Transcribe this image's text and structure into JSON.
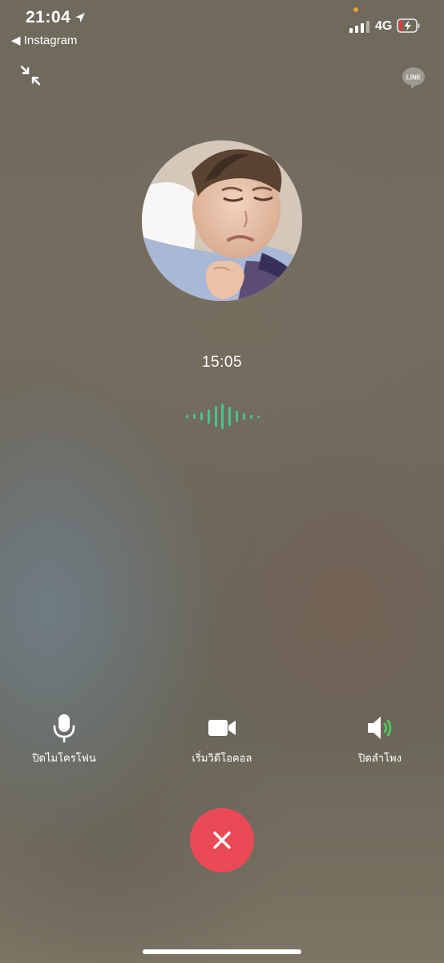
{
  "status_bar": {
    "time": "21:04",
    "back_app": "◀ Instagram",
    "network": "4G",
    "icons": [
      "location-arrow-icon",
      "signal-icon",
      "battery-charging-icon"
    ],
    "orange_dot_color": "#f39a32"
  },
  "call": {
    "timer": "15:05",
    "avatar_icon": "contact-avatar",
    "app_logo_text": "LINE"
  },
  "controls": {
    "mute_label": "ปิดไมโครโฟน",
    "video_label": "เริ่มวิดีโอคอล",
    "speaker_label": "ปิดลำโพง"
  },
  "colors": {
    "end_call": "#e94a56",
    "waveform": "#48c38e",
    "speaker_wave": "#4cd25a"
  }
}
